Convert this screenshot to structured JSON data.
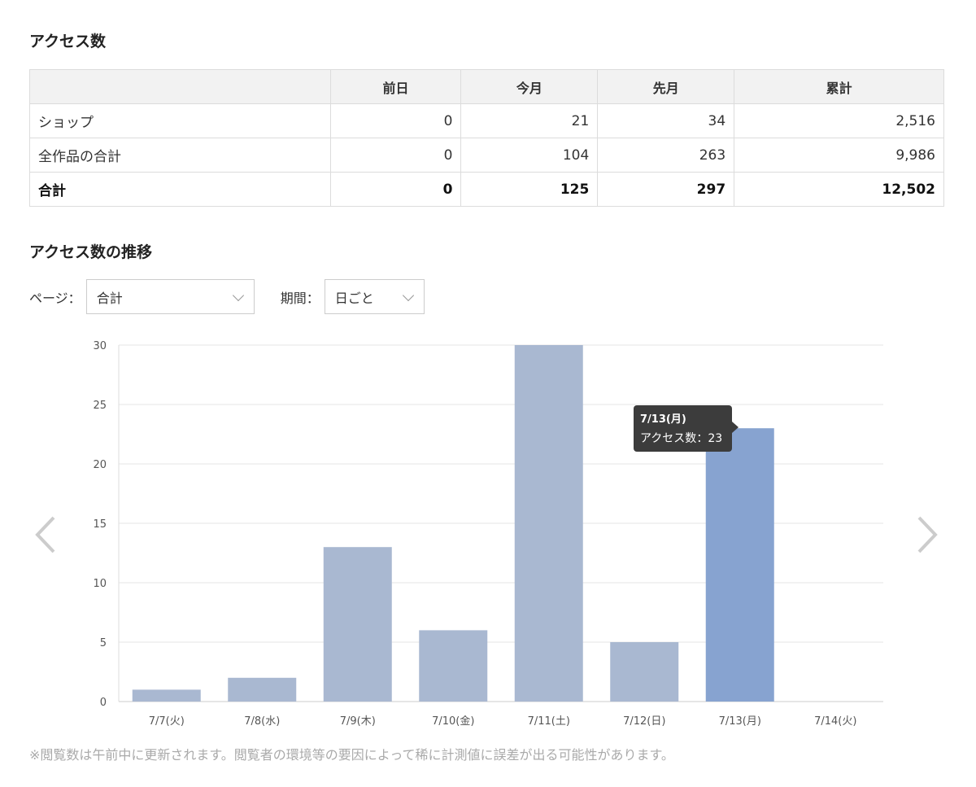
{
  "summary": {
    "title": "アクセス数",
    "headers": [
      "",
      "前日",
      "今月",
      "先月",
      "累計"
    ],
    "rows": [
      {
        "label": "ショップ",
        "prev_day": "0",
        "this_month": "21",
        "last_month": "34",
        "total": "2,516"
      },
      {
        "label": "全作品の合計",
        "prev_day": "0",
        "this_month": "104",
        "last_month": "263",
        "total": "9,986"
      },
      {
        "label": "合計",
        "prev_day": "0",
        "this_month": "125",
        "last_month": "297",
        "total": "12,502"
      }
    ]
  },
  "trend": {
    "title": "アクセス数の推移",
    "page_label": "ページ：",
    "page_value": "合計",
    "period_label": "期間：",
    "period_value": "日ごと"
  },
  "tooltip": {
    "date": "7/13(月)",
    "series": "アクセス数",
    "separator": "：",
    "value": "23"
  },
  "colors": {
    "bar": "#a9b8d1",
    "bar_highlight": "#87a3d0",
    "grid": "#e6e6e6",
    "arrow": "#cccccc"
  },
  "icons": {
    "prev": "chevron-left-icon",
    "next": "chevron-right-icon",
    "dropdown": "chevron-down-icon"
  },
  "chart_data": {
    "type": "bar",
    "categories": [
      "7/7(火)",
      "7/8(水)",
      "7/9(木)",
      "7/10(金)",
      "7/11(土)",
      "7/12(日)",
      "7/13(月)",
      "7/14(火)"
    ],
    "series": [
      {
        "name": "アクセス数",
        "values": [
          1,
          2,
          13,
          6,
          30,
          5,
          23,
          0
        ]
      }
    ],
    "highlight_index": 6,
    "ylim": [
      0,
      30
    ],
    "yticks": [
      0,
      5,
      10,
      15,
      20,
      25,
      30
    ],
    "grid": true
  },
  "footer_note": "※閲覧数は午前中に更新されます。閲覧者の環境等の要因によって稀に計測値に誤差が出る可能性があります。"
}
